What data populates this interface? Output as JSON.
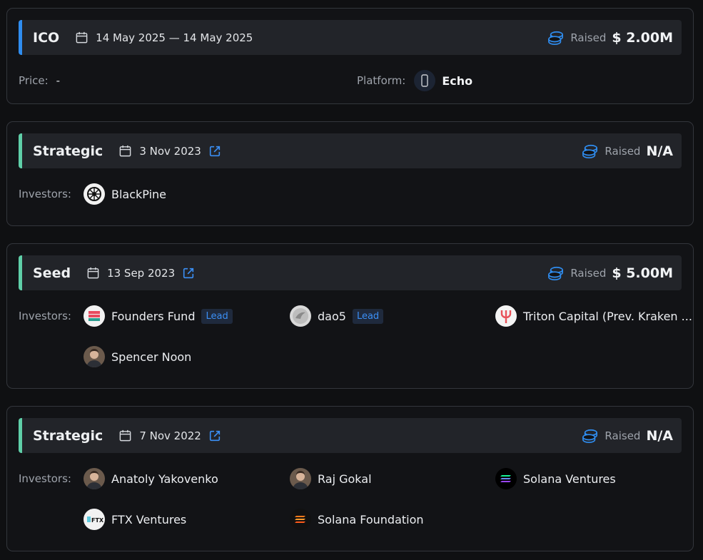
{
  "colors": {
    "accent_blue": "#2f8df0",
    "accent_green": "#5fcfa8",
    "link_blue": "#3b8ff5"
  },
  "rounds": [
    {
      "type": "ICO",
      "date": "14 May 2025 — 14 May 2025",
      "raised_label": "Raised",
      "raised_value": "$ 2.00M",
      "price_label": "Price:",
      "price_value": "-",
      "platform_label": "Platform:",
      "platform_value": "Echo"
    },
    {
      "type": "Strategic",
      "date": "3 Nov 2023",
      "raised_label": "Raised",
      "raised_value": "N/A",
      "investors_label": "Investors:",
      "investors": [
        {
          "name": "BlackPine",
          "icon": "blackpine-logo"
        }
      ]
    },
    {
      "type": "Seed",
      "date": "13 Sep 2023",
      "raised_label": "Raised",
      "raised_value": "$ 5.00M",
      "investors_label": "Investors:",
      "investors": [
        {
          "name": "Founders Fund",
          "badge": "Lead",
          "icon": "founders-fund-logo"
        },
        {
          "name": "dao5",
          "badge": "Lead",
          "icon": "dao5-logo"
        },
        {
          "name": "Triton Capital (Prev. Kraken ...",
          "icon": "triton-capital-logo"
        },
        {
          "name": "Spencer Noon",
          "icon": "person-avatar"
        }
      ]
    },
    {
      "type": "Strategic",
      "date": "7 Nov 2022",
      "raised_label": "Raised",
      "raised_value": "N/A",
      "investors_label": "Investors:",
      "investors": [
        {
          "name": "Anatoly Yakovenko",
          "icon": "person-avatar"
        },
        {
          "name": "Raj Gokal",
          "icon": "person-avatar"
        },
        {
          "name": "Solana Ventures",
          "icon": "solana-logo"
        },
        {
          "name": "FTX Ventures",
          "icon": "ftx-logo"
        },
        {
          "name": "Solana Foundation",
          "icon": "solana-foundation-logo"
        }
      ]
    }
  ]
}
